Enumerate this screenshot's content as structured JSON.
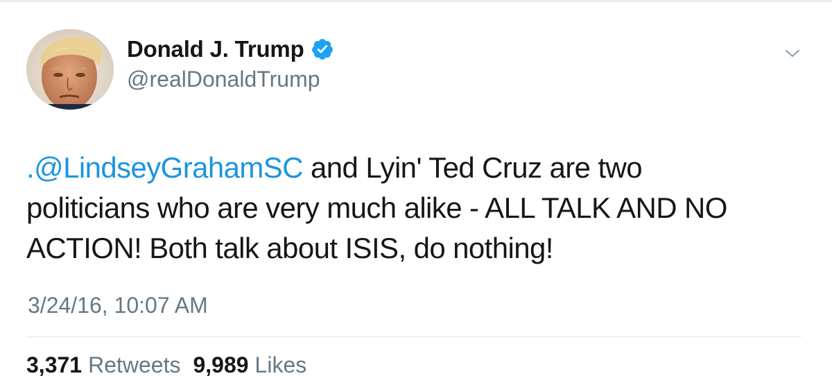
{
  "author": {
    "display_name": "Donald J. Trump",
    "handle": "@realDonaldTrump",
    "verified": true,
    "avatar_icon": "profile-photo"
  },
  "tweet": {
    "mention": ".@LindseyGrahamSC",
    "line1_rest": " and Lyin' Ted Cruz are two",
    "line2": "politicians who are very much alike - ALL TALK AND NO",
    "line3": "ACTION! Both talk about ISIS, do nothing!",
    "timestamp": "3/24/16, 10:07 AM"
  },
  "stats": {
    "retweets_count": "3,371",
    "retweets_label": "Retweets",
    "likes_count": "9,989",
    "likes_label": "Likes"
  },
  "menu": {
    "icon": "chevron-down-icon"
  },
  "colors": {
    "link": "#1b95e0",
    "verified": "#1da1f2",
    "secondary_text": "#657786",
    "primary_text": "#14171a",
    "divider": "#e1e8ed"
  }
}
